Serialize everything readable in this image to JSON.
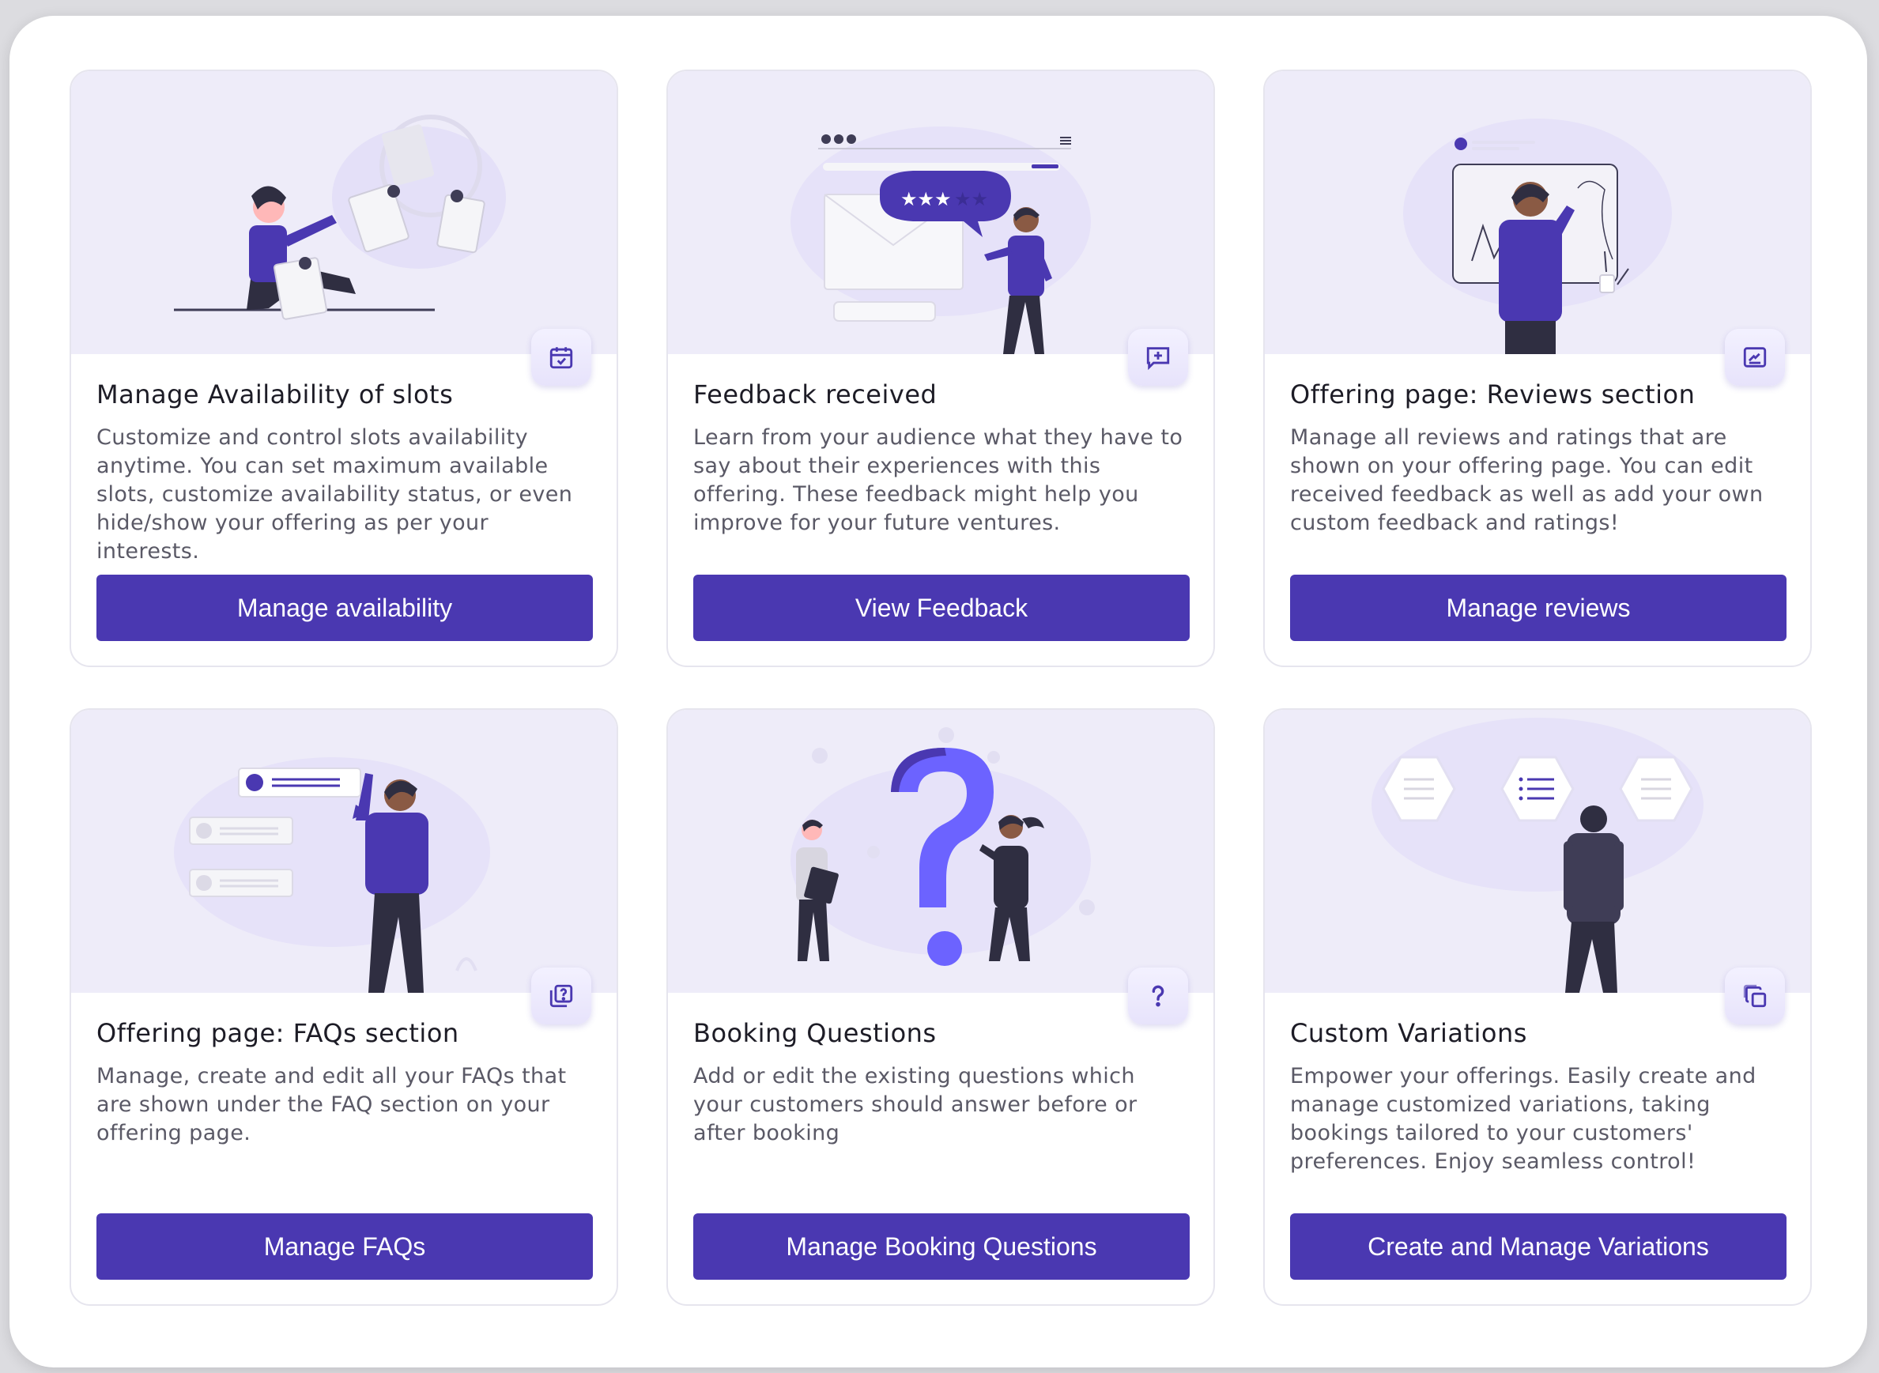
{
  "colors": {
    "accent": "#4a38b1",
    "hero_background": "#eeecf9",
    "title_text": "#1d1c26",
    "body_text": "#5a5966"
  },
  "cards": [
    {
      "title": "Manage Availability of slots",
      "description": "Customize and control slots availability anytime. You can set maximum available slots, customize availability status, or even hide/show your offering as per your interests.",
      "button": "Manage availability",
      "icon": "calendar-check-icon"
    },
    {
      "title": "Feedback received",
      "description": "Learn from your audience what they have to say about their experiences with this offering. These feedback might help you improve for your future ventures.",
      "button": "View Feedback",
      "icon": "message-plus-icon"
    },
    {
      "title": "Offering page: Reviews section",
      "description": "Manage all reviews and ratings that are shown on your offering page. You can edit received feedback as well as add your own custom feedback and ratings!",
      "button": "Manage reviews",
      "icon": "signature-icon"
    },
    {
      "title": "Offering page: FAQs section",
      "description": "Manage, create and edit all your FAQs that are shown under the FAQ section on your offering page.",
      "button": "Manage FAQs",
      "icon": "question-pages-icon"
    },
    {
      "title": "Booking Questions",
      "description": "Add or edit the existing questions which your customers should answer before or after booking",
      "button": "Manage Booking Questions",
      "icon": "question-mark-icon"
    },
    {
      "title": "Custom Variations",
      "description": "Empower your offerings. Easily create and manage customized variations, taking bookings tailored to your customers' preferences. Enjoy seamless control!",
      "button": "Create and Manage Variations",
      "icon": "copy-stack-icon"
    }
  ]
}
